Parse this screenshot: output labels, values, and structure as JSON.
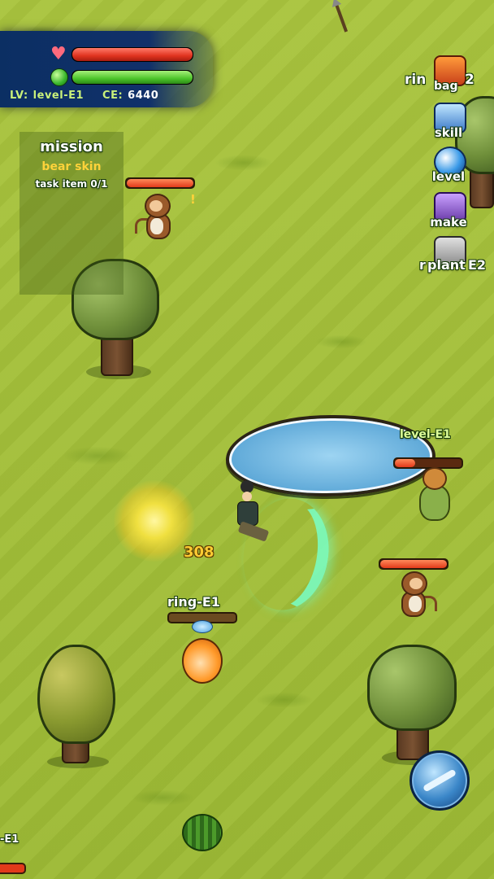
{
  "player": {
    "hp_fraction": 1.0,
    "mp_fraction": 1.0,
    "level_label": "LV:",
    "level_value": "level-E1",
    "ce_label": "CE:",
    "ce_value": "6440"
  },
  "mission": {
    "title": "mission",
    "target": "bear skin",
    "item": "task item 0/1"
  },
  "menu": {
    "bag": "bag",
    "bag_overlap": "rin",
    "bag_overlap_suffix": "2",
    "skill": "skill",
    "level": "level",
    "make": "make",
    "plant": "plant",
    "plant_overlap_prefix": "r",
    "plant_overlap_suffix": "E2"
  },
  "enemies": {
    "monkey_top_hp": 1.0,
    "ape_label": "level-E1",
    "ape_hp": 0.3,
    "monkey_right_hp": 1.0,
    "fox_label": "ring-E1",
    "fox_hp": 0.0,
    "edge_label": "-E1"
  },
  "combat": {
    "damage": "308"
  },
  "alerts": {
    "exclamation": "!"
  },
  "colors": {
    "grass": "#a7c23b",
    "hp": "#e0331f",
    "mp": "#4cc42a",
    "mission_target": "#ffd23a"
  }
}
